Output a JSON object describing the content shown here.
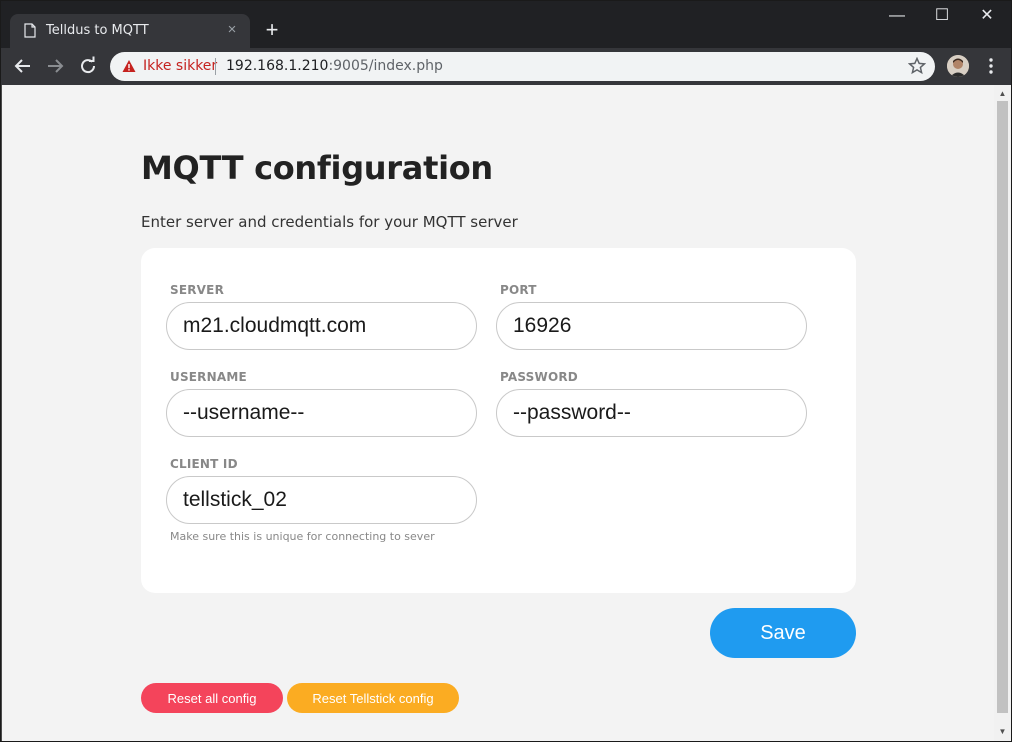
{
  "browser": {
    "tab_title": "Telldus to MQTT",
    "security_label": "Ikke sikker",
    "url_host": "192.168.1.210",
    "url_path": ":9005/index.php",
    "tab_close_glyph": "×",
    "new_tab_glyph": "+",
    "minimize_glyph": "—",
    "maximize_glyph": "☐",
    "close_glyph": "✕",
    "icons": [
      "document-icon",
      "back-arrow-icon",
      "forward-arrow-icon",
      "reload-icon",
      "warning-icon",
      "star-icon",
      "avatar",
      "kebab-menu-icon"
    ]
  },
  "page": {
    "title": "MQTT configuration",
    "subtitle": "Enter server and credentials for your MQTT server"
  },
  "form": {
    "server": {
      "label": "SERVER",
      "value": "m21.cloudmqtt.com"
    },
    "port": {
      "label": "PORT",
      "value": "16926"
    },
    "username": {
      "label": "USERNAME",
      "value": "--username--"
    },
    "password": {
      "label": "PASSWORD",
      "value": "--password--"
    },
    "client_id": {
      "label": "CLIENT ID",
      "value": "tellstick_02",
      "hint": "Make sure this is unique for connecting to sever"
    }
  },
  "actions": {
    "save_label": "Save",
    "reset_all_label": "Reset all config",
    "reset_tellstick_label": "Reset Tellstick config"
  },
  "colors": {
    "save": "#1f9bf0",
    "reset_all": "#f4445b",
    "reset_tellstick": "#fbac22",
    "insecure": "#c5221f"
  }
}
